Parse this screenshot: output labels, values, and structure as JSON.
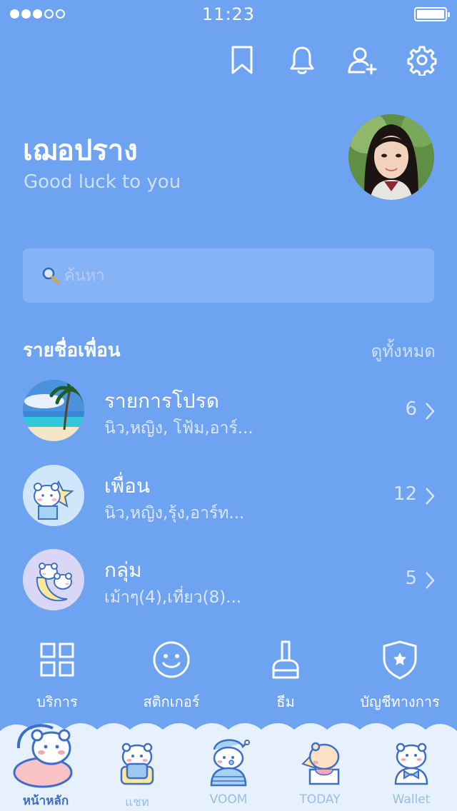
{
  "status_bar": {
    "time": "11:23"
  },
  "top_icons": [
    "bookmark-icon",
    "bell-icon",
    "add-friend-icon",
    "gear-icon"
  ],
  "profile": {
    "name": "เฌอปราง",
    "status_message": "Good luck to you"
  },
  "search": {
    "placeholder": "ค้นหา"
  },
  "friends_section": {
    "title": "รายชื่อเพื่อน",
    "see_all": "ดูทั้งหมด"
  },
  "lists": [
    {
      "title": "รายการโปรด",
      "subtitle": "นิว,หญิง, โฟ้ม,อาร์...",
      "count": "6"
    },
    {
      "title": "เพื่อน",
      "subtitle": "นิว,หญิง,รุ้ง,อาร์ท...",
      "count": "12"
    },
    {
      "title": "กลุ่ม",
      "subtitle": "เม้าๆ(4),เที่ยว(8)...",
      "count": "5"
    }
  ],
  "services": [
    {
      "label": "บริการ",
      "icon": "grid-icon"
    },
    {
      "label": "สติกเกอร์",
      "icon": "smiley-icon"
    },
    {
      "label": "ธีม",
      "icon": "brush-icon"
    },
    {
      "label": "บัญชีทางการ",
      "icon": "shield-star-icon"
    }
  ],
  "tabs": [
    {
      "label": "หน้าหลัก",
      "active": true
    },
    {
      "label": "แชท",
      "active": false
    },
    {
      "label": "VOOM",
      "active": false
    },
    {
      "label": "TODAY",
      "active": false
    },
    {
      "label": "Wallet",
      "active": false
    }
  ],
  "colors": {
    "background": "#6ea3f2",
    "search_bg": "#86b3f5",
    "tab_active": "#3d6fc7",
    "tabbar_bg": "#e6f1fd"
  }
}
